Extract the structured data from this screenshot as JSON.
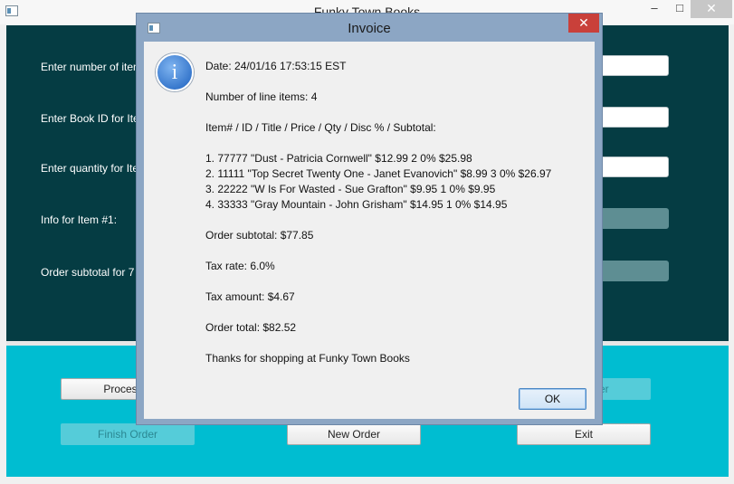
{
  "main_window": {
    "title": "Funky Town Books",
    "minimize_glyph": "–",
    "maximize_glyph": "□",
    "close_glyph": "✕"
  },
  "form": {
    "labels": [
      "Enter number of item",
      "Enter Book ID for Ite",
      "Enter quantity for Ite",
      "Info for Item #1:",
      "Order subtotal for 7"
    ]
  },
  "buttons": {
    "process_item": "Process It",
    "confirm_item_fragment": "er",
    "finish_order": "Finish Order",
    "new_order": "New Order",
    "exit": "Exit"
  },
  "dialog": {
    "title": "Invoice",
    "close_glyph": "✕",
    "icon_glyph": "i",
    "ok": "OK",
    "lines": [
      "Date: 24/01/16 17:53:15 EST",
      "Number of line items: 4",
      "Item# / ID / Title / Price / Qty / Disc % / Subtotal:",
      "1. 77777 \"Dust - Patricia Cornwell\" $12.99 2 0% $25.98",
      "2. 11111 \"Top Secret Twenty One - Janet Evanovich\" $8.99 3 0% $26.97",
      "3. 22222 \"W Is For Wasted - Sue Grafton\" $9.95 1 0% $9.95",
      "4. 33333 \"Gray Mountain - John Grisham\" $14.95 1 0% $14.95",
      "Order subtotal: $77.85",
      "Tax rate: 6.0%",
      "Tax amount: $4.67",
      "Order total: $82.52",
      "Thanks for shopping at Funky Town Books"
    ]
  }
}
